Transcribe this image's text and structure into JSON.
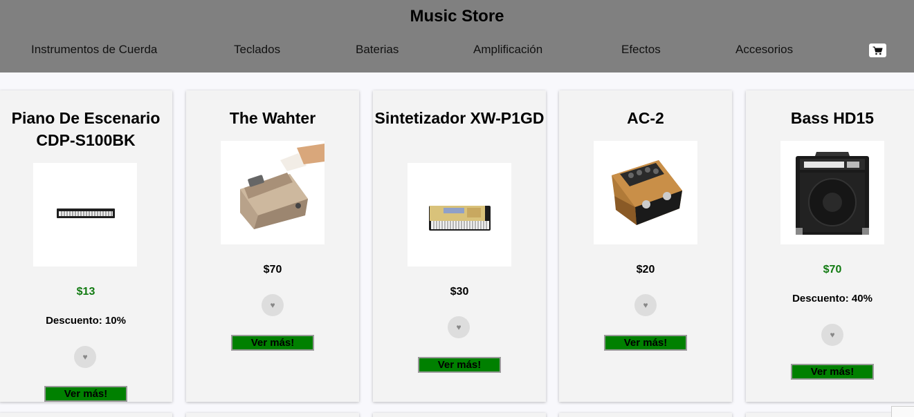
{
  "header": {
    "title": "Music Store",
    "nav": [
      "Instrumentos de Cuerda",
      "Teclados",
      "Baterias",
      "Amplificación",
      "Efectos",
      "Accesorios"
    ],
    "cart_icon": "cart-icon"
  },
  "products": [
    {
      "title": "Piano De Escenario CDP-S100BK",
      "price": "$13",
      "on_sale": true,
      "discount": "Descuento: 10%",
      "button": "Ver más!",
      "fav_icon": "heart-icon"
    },
    {
      "title": "The Wahter",
      "price": "$70",
      "on_sale": false,
      "button": "Ver más!",
      "fav_icon": "heart-icon"
    },
    {
      "title": "Sintetizador XW-P1GD",
      "price": "$30",
      "on_sale": false,
      "button": "Ver más!",
      "fav_icon": "heart-icon"
    },
    {
      "title": "AC-2",
      "price": "$20",
      "on_sale": false,
      "button": "Ver más!",
      "fav_icon": "heart-icon"
    },
    {
      "title": "Bass HD15",
      "price": "$70",
      "on_sale": true,
      "discount": "Descuento: 40%",
      "button": "Ver más!",
      "fav_icon": "heart-icon"
    }
  ],
  "colors": {
    "header_bg": "#808080",
    "button_bg": "#008000",
    "sale_price": "#117a11"
  }
}
